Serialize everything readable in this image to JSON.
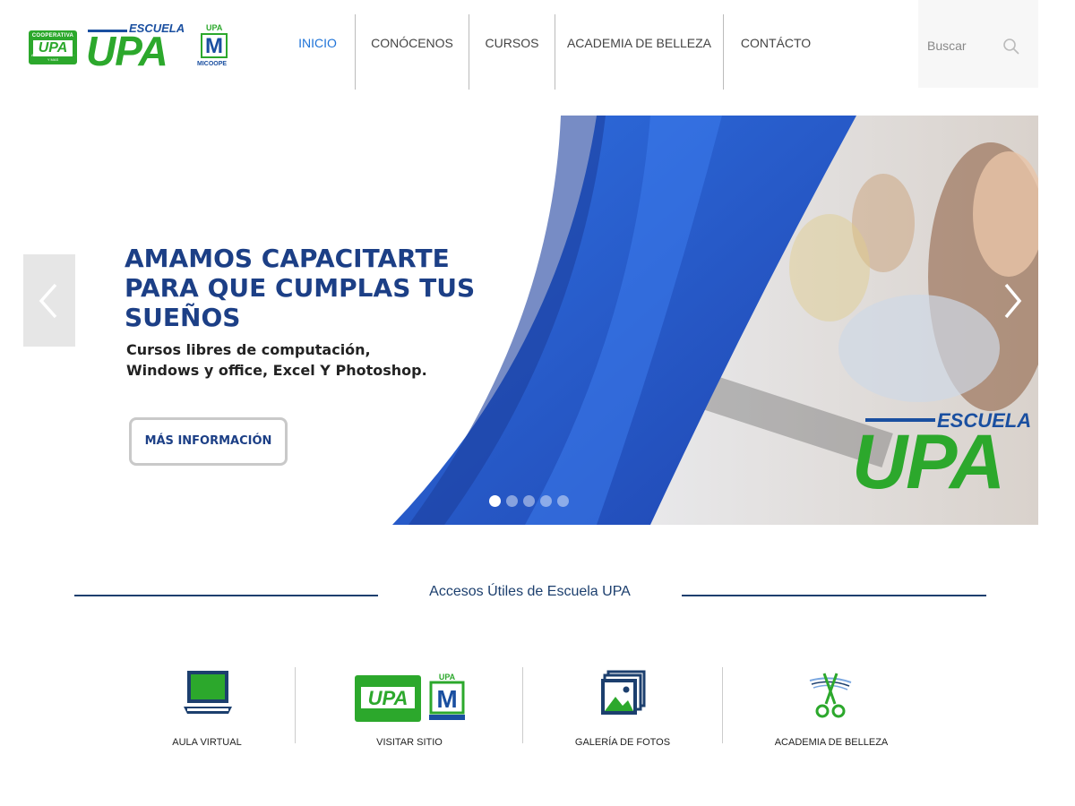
{
  "header": {
    "logo": {
      "coop_top": "COOPERATIVA",
      "coop_main": "UPA",
      "coop_sub": "AHORRO · PRESTAMOS · Y MAS",
      "escuela": "ESCUELA",
      "upa": "UPA",
      "micoope_upa": "UPA",
      "micoope_m": "M",
      "micoope_text": "MICOOPE"
    },
    "nav": [
      {
        "label": "INICIO",
        "active": true
      },
      {
        "label": "CONÓCENOS",
        "active": false
      },
      {
        "label": "CURSOS",
        "active": false
      },
      {
        "label": "ACADEMIA DE BELLEZA",
        "active": false
      },
      {
        "label": "CONTÁCTO",
        "active": false
      }
    ],
    "search": {
      "placeholder": "Buscar",
      "icon": "search-icon"
    }
  },
  "hero": {
    "title_lines": [
      "AMAMOS CAPACITARTE",
      "PARA QUE CUMPLAS TUS",
      "SUEÑOS"
    ],
    "subtitle_lines": [
      "Cursos libres de computación,",
      "Windows y office, Excel Y Photoshop."
    ],
    "button_label": "MÁS INFORMACIÓN",
    "logo_escuela": "ESCUELA",
    "logo_upa": "UPA",
    "slides_total": 5,
    "active_slide": 1,
    "colors": {
      "brand_blue": "#1c3f86",
      "brand_green": "#2ca82c",
      "wave_blue": "#2b5fd0"
    }
  },
  "section": {
    "title": "Accesos Útiles de Escuela UPA",
    "items": [
      {
        "label": "AULA VIRTUAL",
        "icon": "laptop-icon"
      },
      {
        "label": "VISITAR SITIO",
        "icon": "upa-logo-icon"
      },
      {
        "label": "GALERÍA DE FOTOS",
        "icon": "photo-gallery-icon"
      },
      {
        "label": "ACADEMIA DE BELLEZA",
        "icon": "scissors-icon"
      }
    ]
  }
}
